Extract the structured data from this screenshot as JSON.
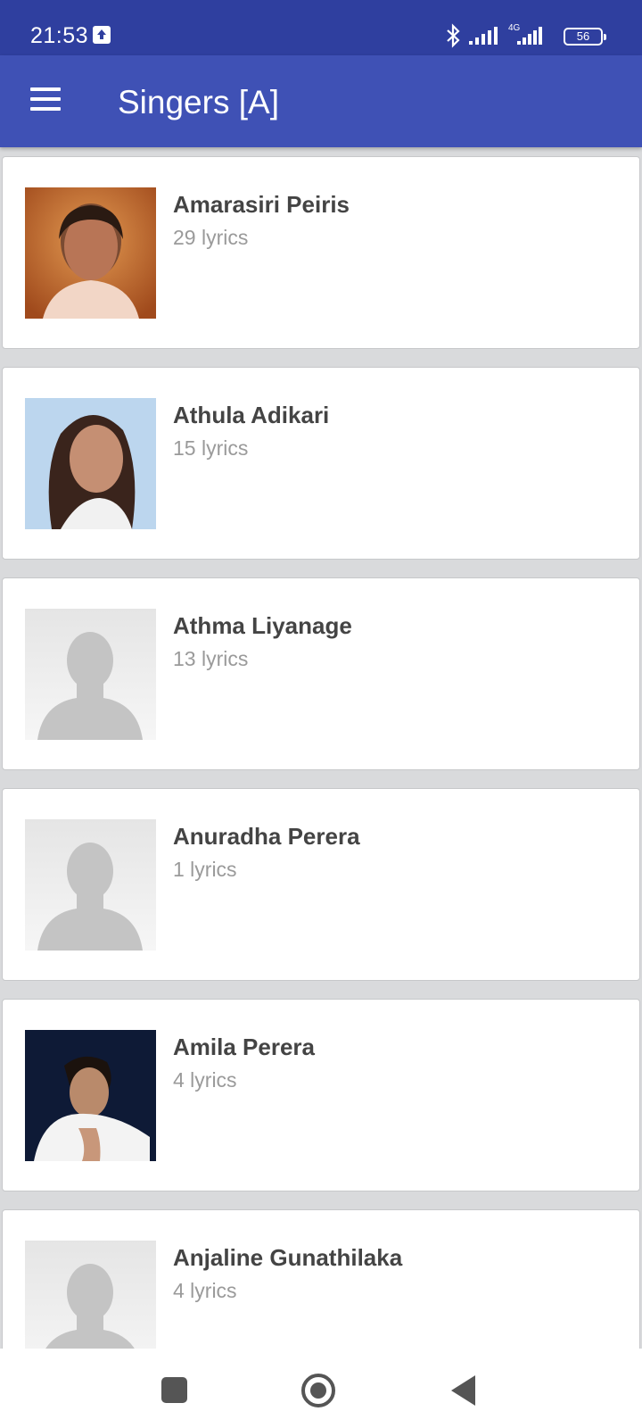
{
  "status_bar": {
    "time": "21:53",
    "network": "4G",
    "battery": "56"
  },
  "app_bar": {
    "title": "Singers [A]"
  },
  "singers": [
    {
      "name": "Amarasiri Peiris",
      "lyrics": "29 lyrics",
      "avatar": "photo"
    },
    {
      "name": "Athula Adikari",
      "lyrics": "15 lyrics",
      "avatar": "photo"
    },
    {
      "name": "Athma Liyanage",
      "lyrics": "13 lyrics",
      "avatar": "placeholder"
    },
    {
      "name": "Anuradha Perera",
      "lyrics": "1 lyrics",
      "avatar": "placeholder"
    },
    {
      "name": "Amila Perera",
      "lyrics": "4 lyrics",
      "avatar": "photo"
    },
    {
      "name": "Anjaline Gunathilaka",
      "lyrics": "4 lyrics",
      "avatar": "placeholder"
    }
  ],
  "colors": {
    "status_bar": "#2f3f9f",
    "app_bar": "#3f51b5",
    "background": "#d9dadc"
  }
}
